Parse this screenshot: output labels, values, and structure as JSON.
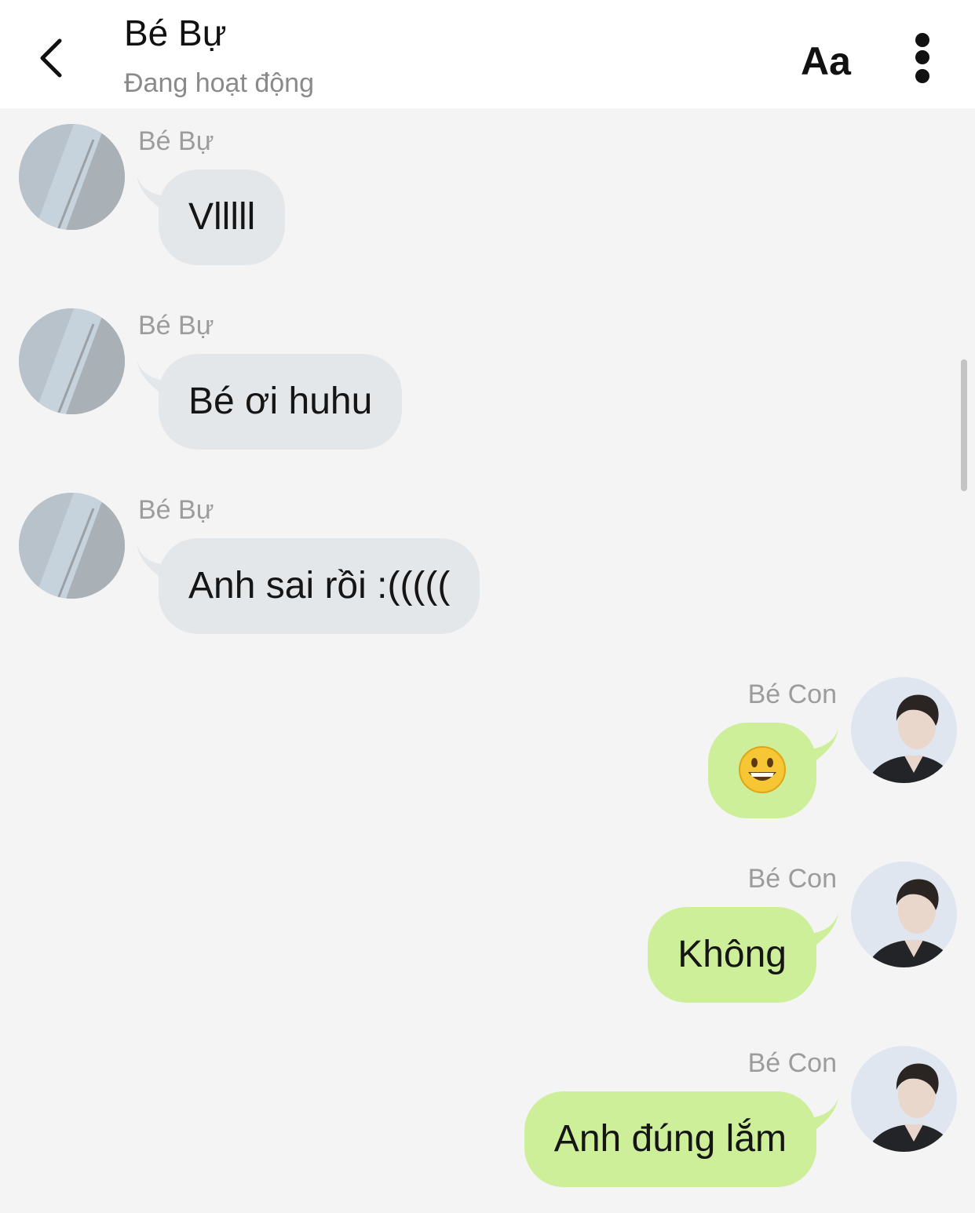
{
  "header": {
    "title": "Bé Bự",
    "status": "Đang hoạt động",
    "font_button_label": "Aa",
    "back_icon": "chevron-left-icon",
    "more_icon": "more-vertical-icon"
  },
  "colors": {
    "incoming_bubble": "#e4e7ea",
    "outgoing_bubble": "#cdef99",
    "background": "#f4f4f4"
  },
  "messages": [
    {
      "direction": "in",
      "sender": "Bé Bự",
      "text": "Vlllll"
    },
    {
      "direction": "in",
      "sender": "Bé Bự",
      "text": "Bé ơi huhu"
    },
    {
      "direction": "in",
      "sender": "Bé Bự",
      "text": "Anh sai rồi :((((("
    },
    {
      "direction": "out",
      "sender": "Bé Con",
      "text": "",
      "emoji": "smiling-face-emoji"
    },
    {
      "direction": "out",
      "sender": "Bé Con",
      "text": "Không"
    },
    {
      "direction": "out",
      "sender": "Bé Con",
      "text": "Anh đúng lắm"
    }
  ]
}
